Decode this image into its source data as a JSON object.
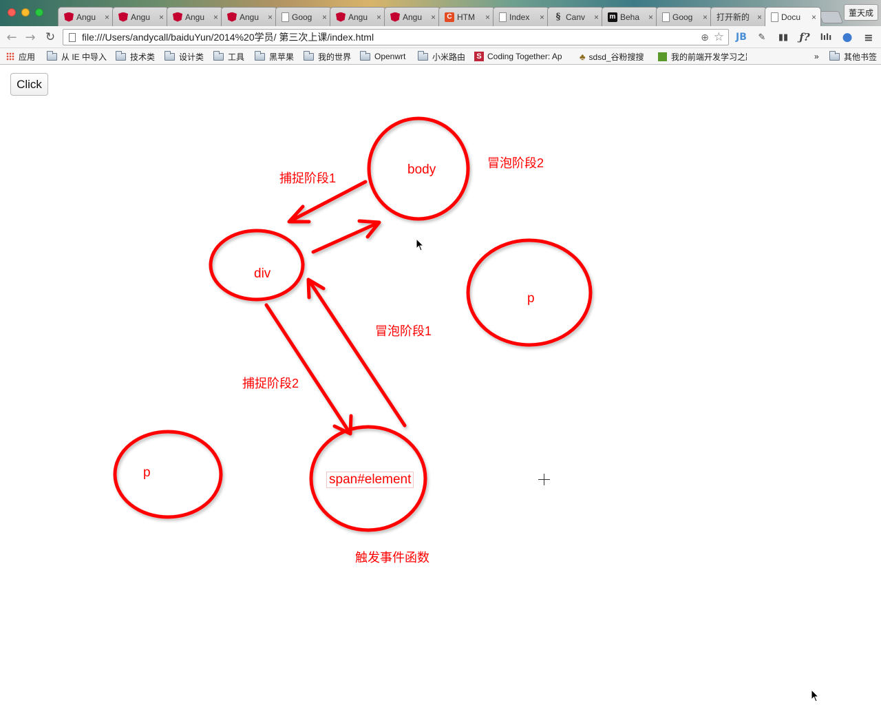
{
  "browser": {
    "tabs": [
      {
        "label": "Angu",
        "icon": "angular-icon",
        "active": false
      },
      {
        "label": "Angu",
        "icon": "angular-icon",
        "active": false
      },
      {
        "label": "Angu",
        "icon": "angular-icon",
        "active": false
      },
      {
        "label": "Angu",
        "icon": "angular-icon",
        "active": false
      },
      {
        "label": "Goog",
        "icon": "document-icon",
        "active": false
      },
      {
        "label": "Angu",
        "icon": "angular-icon",
        "active": false
      },
      {
        "label": "Angu",
        "icon": "angular-icon",
        "active": false
      },
      {
        "label": "HTM",
        "icon": "html-icon",
        "active": false
      },
      {
        "label": "Index",
        "icon": "document-icon",
        "active": false
      },
      {
        "label": "Canv",
        "icon": "canvas-icon",
        "active": false
      },
      {
        "label": "Beha",
        "icon": "m-icon",
        "active": false
      },
      {
        "label": "Goog",
        "icon": "document-icon",
        "active": false
      },
      {
        "label": "打开新的",
        "icon": "none",
        "active": false
      },
      {
        "label": "Docu",
        "icon": "document-icon",
        "active": true
      }
    ],
    "tab_close_glyph": "×",
    "user_name": "董天成",
    "url": "file:///Users/andycall/baiduYun/2014%20学员/ 第三次上课/index.html",
    "extensions": [
      "JB",
      "ƒ?",
      "lılı"
    ],
    "bookmarks": [
      {
        "label": "应用",
        "icon": "apps-icon"
      },
      {
        "label": "从 IE 中导入",
        "icon": "folder-icon"
      },
      {
        "label": "技术类",
        "icon": "folder-icon"
      },
      {
        "label": "设计类",
        "icon": "folder-icon"
      },
      {
        "label": "工具",
        "icon": "folder-icon"
      },
      {
        "label": "黑苹果",
        "icon": "folder-icon"
      },
      {
        "label": "我的世界",
        "icon": "folder-icon"
      },
      {
        "label": "Openwrt",
        "icon": "folder-icon"
      },
      {
        "label": "小米路由",
        "icon": "folder-icon"
      },
      {
        "label": "Coding Together: Ap",
        "icon": "s-icon"
      },
      {
        "label": "sdsd_谷粉搜搜",
        "icon": "owl-icon"
      },
      {
        "label": "我的前端开发学习之路",
        "icon": "book-icon"
      },
      {
        "label": "»",
        "icon": "none"
      },
      {
        "label": "其他书签",
        "icon": "folder-icon"
      }
    ]
  },
  "page": {
    "click_button_label": "Click",
    "nodes": {
      "body": "body",
      "div": "div",
      "p_right": "p",
      "p_left": "p",
      "span": "span#element"
    },
    "stages": {
      "capture1": "捕捉阶段1",
      "capture2": "捕捉阶段2",
      "bubble1": "冒泡阶段1",
      "bubble2": "冒泡阶段2",
      "trigger": "触发事件函数"
    },
    "diagram_color": "#ff0000"
  }
}
